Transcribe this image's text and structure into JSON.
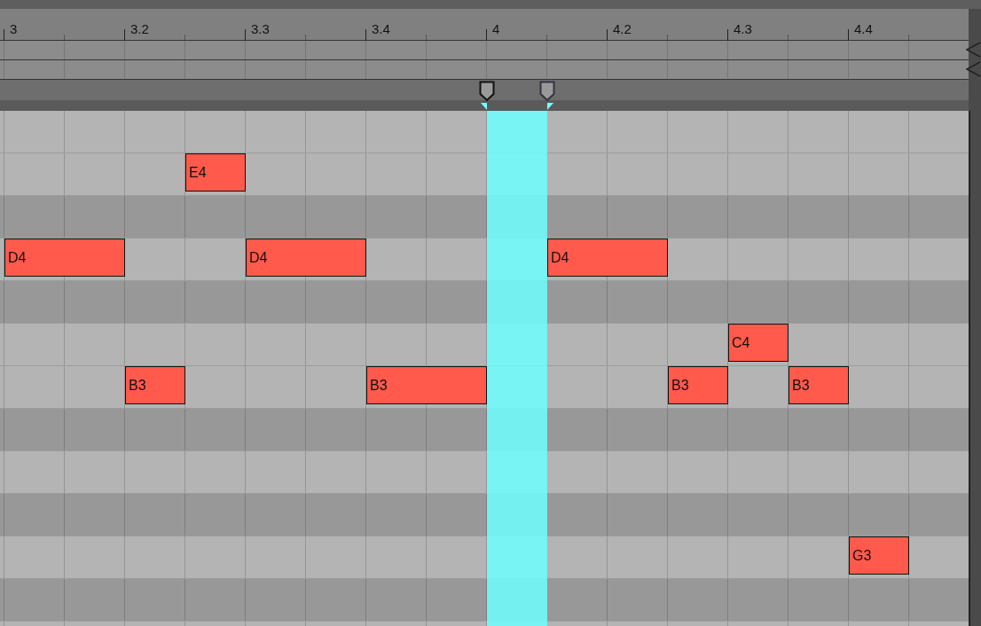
{
  "ruler": {
    "labels": [
      "3",
      "3.2",
      "3.3",
      "3.4",
      "4",
      "4.2",
      "4.3",
      "4.4"
    ]
  },
  "rows": [
    {
      "black": false,
      "notes": []
    },
    {
      "black": false,
      "notes": [
        {
          "label": "E4"
        }
      ]
    },
    {
      "black": true,
      "notes": []
    },
    {
      "black": false,
      "notes": [
        {
          "label": "D4"
        },
        {
          "label": "D4"
        },
        {
          "label": "D4"
        }
      ]
    },
    {
      "black": true,
      "notes": []
    },
    {
      "black": false,
      "notes": [
        {
          "label": "C4"
        }
      ]
    },
    {
      "black": false,
      "notes": [
        {
          "label": "B3"
        },
        {
          "label": "B3"
        },
        {
          "label": "B3"
        },
        {
          "label": "B3"
        }
      ]
    },
    {
      "black": true,
      "notes": []
    },
    {
      "black": false,
      "notes": []
    },
    {
      "black": true,
      "notes": []
    },
    {
      "black": false,
      "notes": [
        {
          "label": "G3"
        }
      ]
    },
    {
      "black": true,
      "notes": []
    },
    {
      "black": false,
      "notes": []
    }
  ]
}
